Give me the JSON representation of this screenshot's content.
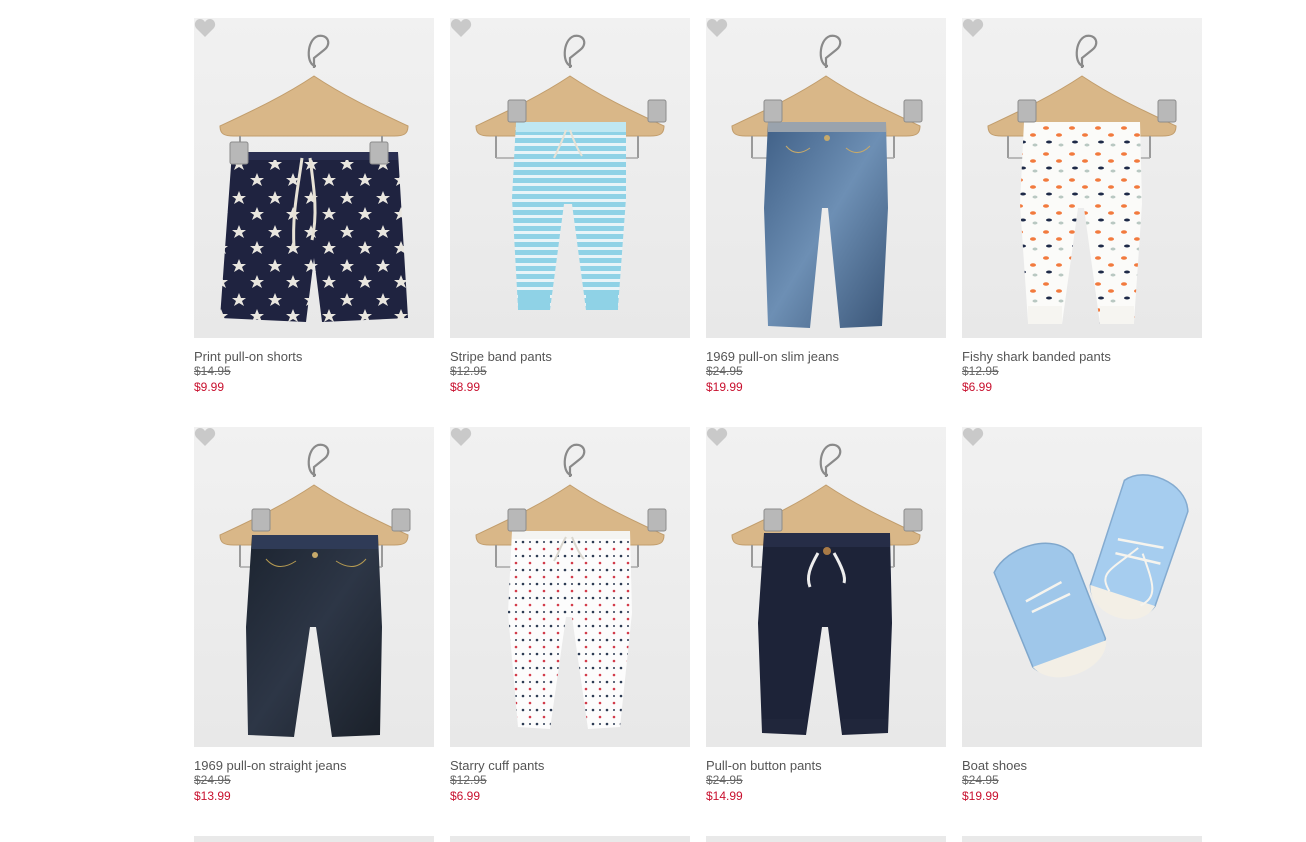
{
  "colors": {
    "sale_price": "#c8102e",
    "name_text": "#555555",
    "was_price": "#666666",
    "heart": "#c9c9c9"
  },
  "products": [
    {
      "name": "Print pull-on shorts",
      "was": "$14.95",
      "now": "$9.99",
      "image": "navy-star-shorts",
      "icon": "heart-icon"
    },
    {
      "name": "Stripe band pants",
      "was": "$12.95",
      "now": "$8.99",
      "image": "blue-stripe-pants",
      "icon": "heart-icon"
    },
    {
      "name": "1969 pull-on slim jeans",
      "was": "$24.95",
      "now": "$19.99",
      "image": "denim-slim-jeans",
      "icon": "heart-icon"
    },
    {
      "name": "Fishy shark banded pants",
      "was": "$12.95",
      "now": "$6.99",
      "image": "fish-print-pants",
      "icon": "heart-icon"
    },
    {
      "name": "1969 pull-on straight jeans",
      "was": "$24.95",
      "now": "$13.99",
      "image": "dark-straight-jeans",
      "icon": "heart-icon"
    },
    {
      "name": "Starry cuff pants",
      "was": "$12.95",
      "now": "$6.99",
      "image": "dot-cuff-pants",
      "icon": "heart-icon"
    },
    {
      "name": "Pull-on button pants",
      "was": "$24.95",
      "now": "$14.99",
      "image": "navy-button-pants",
      "icon": "heart-icon"
    },
    {
      "name": "Boat shoes",
      "was": "$24.95",
      "now": "$19.99",
      "image": "blue-boat-shoes",
      "icon": "heart-icon"
    }
  ]
}
